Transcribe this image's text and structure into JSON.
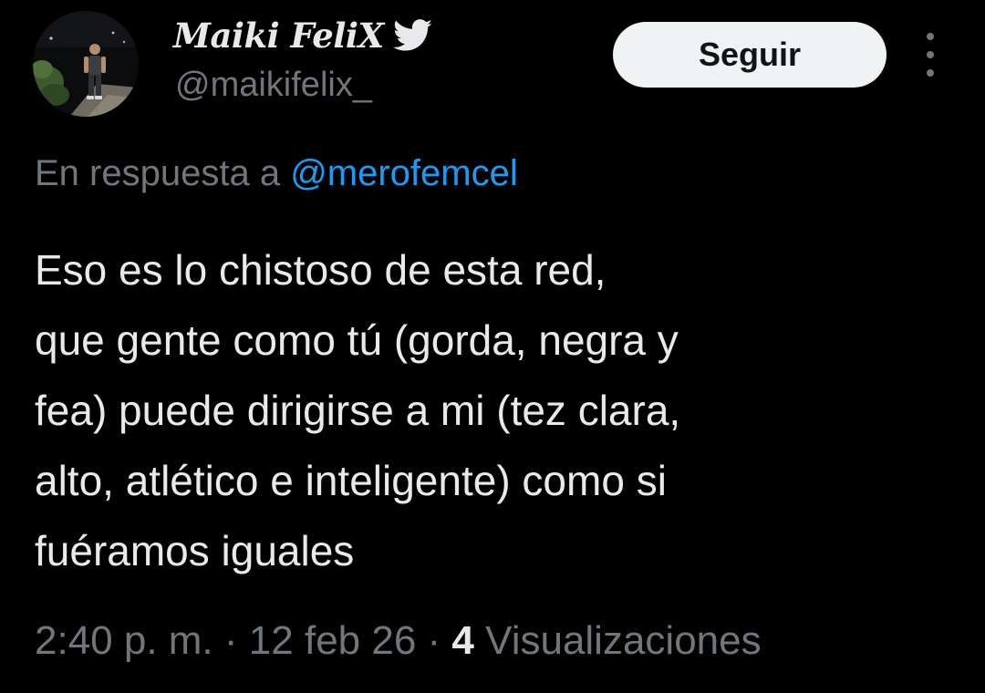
{
  "author": {
    "display_name": "Maiki FeliX",
    "handle": "@maikifelix_",
    "badge_icon": "twitter-bird-icon"
  },
  "actions": {
    "follow_label": "Seguir",
    "more_icon": "more-vertical-icon"
  },
  "reply": {
    "prefix": "En respuesta a",
    "mention": "@merofemcel"
  },
  "tweet": {
    "lines": [
      "Eso es lo chistoso de esta red,",
      "que gente como tú (gorda, negra y",
      "fea) puede dirigirse a mi (tez clara,",
      "alto, atlético e inteligente) como si",
      "fuéramos iguales"
    ]
  },
  "meta": {
    "time": "2:40 p. m.",
    "separator": "·",
    "date": "12 feb 26",
    "views_count": "4",
    "views_label": "Visualizaciones"
  },
  "colors": {
    "background": "#000000",
    "primary_text": "#e7e9ea",
    "secondary_text": "#71767b",
    "link": "#1d9bf0",
    "follow_button_bg": "#eff3f4"
  }
}
